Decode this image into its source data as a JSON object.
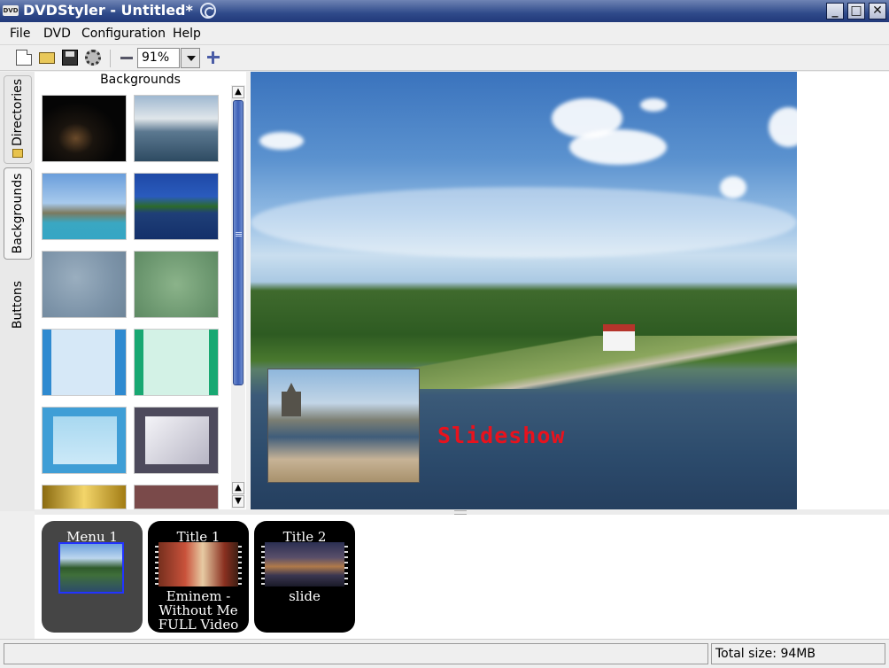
{
  "window": {
    "title": "DVDStyler - Untitled*",
    "app_icon_text": "DVD"
  },
  "menubar": {
    "items": [
      "File",
      "DVD",
      "Configuration",
      "Help"
    ]
  },
  "toolbar": {
    "zoom_value": "91%"
  },
  "side_tabs": [
    "Directories",
    "Backgrounds",
    "Buttons"
  ],
  "backgrounds_panel": {
    "header": "Backgrounds",
    "thumbnails": [
      "night-road",
      "sea-clouds",
      "coast-ship",
      "lake-forest",
      "grey-blue-texture",
      "green-texture",
      "blue-stripes",
      "green-stripes",
      "blue-frame",
      "grey-frame",
      "gold-frame",
      "red-frame"
    ]
  },
  "canvas": {
    "slideshow_label": "Slideshow"
  },
  "titleset": {
    "menus": [
      {
        "caption": "Menu 1"
      }
    ],
    "titles": [
      {
        "caption": "Title 1",
        "subtitle_lines": [
          "Eminem -",
          "Without Me",
          "FULL Video"
        ]
      },
      {
        "caption": "Title 2",
        "subtitle_lines": [
          "slide"
        ]
      }
    ]
  },
  "statusbar": {
    "message": "",
    "total_size": "Total size: 94MB"
  },
  "colors": {
    "titlebar": "#2f4a8a",
    "slideshow_text": "#e8121d",
    "card": "#454545",
    "card_title": "#000000"
  },
  "icons": [
    "new-document-icon",
    "open-folder-icon",
    "save-icon",
    "settings-icon",
    "zoom-out-icon",
    "zoom-in-icon",
    "minimize-icon",
    "maximize-icon",
    "close-icon"
  ]
}
